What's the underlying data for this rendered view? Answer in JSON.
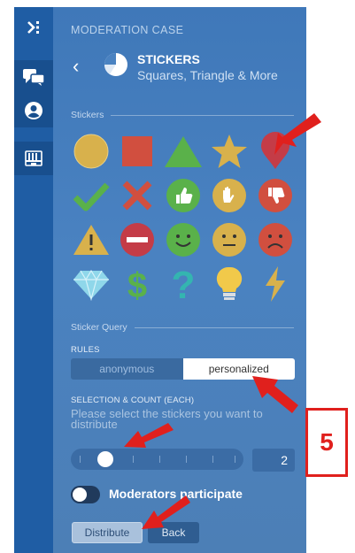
{
  "sidebar": {
    "items": [
      {
        "name": "collapse-icon"
      },
      {
        "name": "chat-icon"
      },
      {
        "name": "user-icon"
      },
      {
        "name": "toolbox-icon"
      }
    ]
  },
  "panel": {
    "case_title": "MODERATION CASE",
    "sticker_set_name": "STICKERS",
    "sticker_set_subtitle": "Squares, Triangle & More",
    "stickers_section": "Stickers",
    "stickers": [
      "yellow-circle-icon",
      "red-square-icon",
      "green-triangle-icon",
      "yellow-star-icon",
      "red-pin-icon",
      "green-check-icon",
      "red-cross-icon",
      "thumbs-up-icon",
      "raised-hand-icon",
      "thumbs-down-icon",
      "warning-icon",
      "no-entry-icon",
      "smiley-happy-icon",
      "smiley-neutral-icon",
      "smiley-sad-icon",
      "diamond-icon",
      "dollar-icon",
      "question-icon",
      "lightbulb-icon",
      "lightning-icon"
    ],
    "query_section": "Sticker Query",
    "rules_label": "RULES",
    "rules_options": [
      "anonymous",
      "personalized"
    ],
    "rules_selected": "personalized",
    "selection_label": "SELECTION & COUNT (EACH)",
    "selection_prompt": "Please select the stickers you want to distribute",
    "count_value": "2",
    "moderators_label": "Moderators participate",
    "moderators_on": false,
    "distribute_label": "Distribute",
    "back_label": "Back"
  },
  "annotation": {
    "step_number": "5",
    "accent_color": "#e0201d"
  }
}
